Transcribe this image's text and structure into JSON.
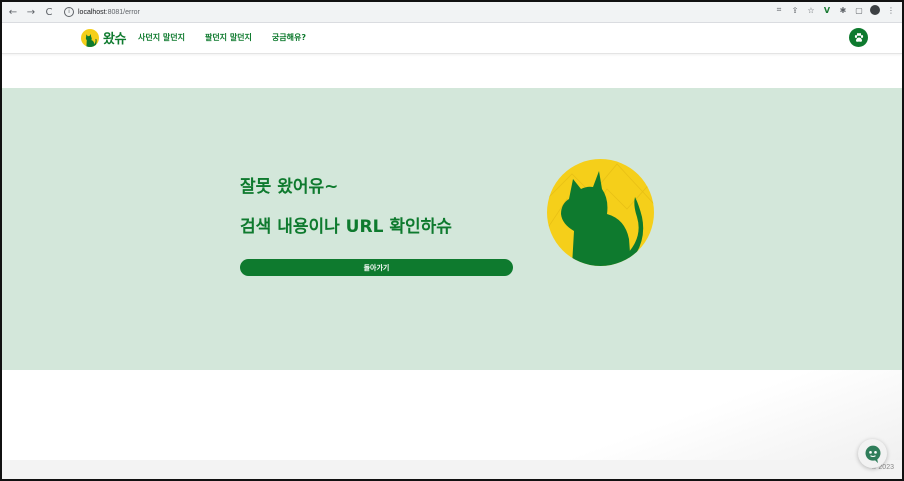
{
  "browser": {
    "url_host": "localhost",
    "url_path": ":8081/error",
    "back_icon": "←",
    "forward_icon": "→",
    "reload_icon": "C"
  },
  "header": {
    "logo_text": "왔슈",
    "nav": [
      "사던지 말던지",
      "팔던지 말던지",
      "궁금해유?"
    ],
    "menu_icon": "paw-icon"
  },
  "hero": {
    "title_line1": "잘못 왔어유~",
    "title_line2": "검색 내용이나 URL 확인하슈",
    "back_button": "돌아가기"
  },
  "footer": {
    "copyright": "© 2023"
  },
  "colors": {
    "brand_green": "#0e7a2e",
    "brand_yellow": "#f5cf1a",
    "hero_bg": "#d3e7da"
  }
}
